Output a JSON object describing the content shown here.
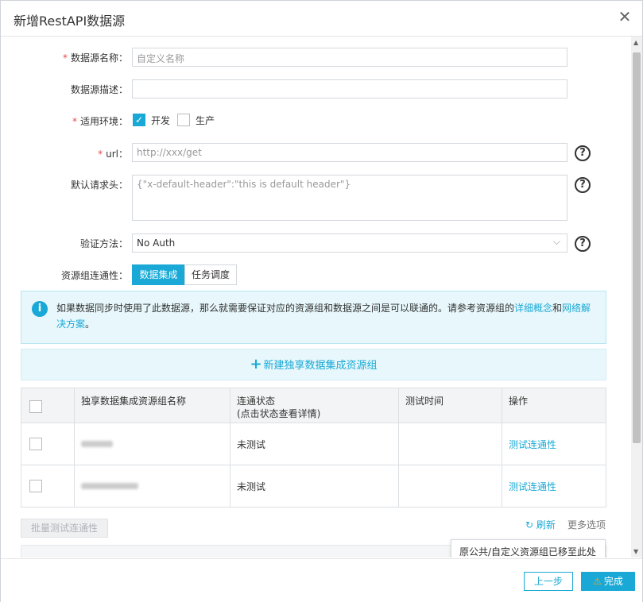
{
  "dialog": {
    "title": "新增RestAPI数据源",
    "close_glyph": "✕"
  },
  "form": {
    "name": {
      "label": "数据源名称：",
      "placeholder": "自定义名称",
      "required": true
    },
    "desc": {
      "label": "数据源描述：",
      "value": ""
    },
    "env": {
      "label": "适用环境：",
      "options": [
        {
          "label": "开发",
          "checked": true
        },
        {
          "label": "生产",
          "checked": false
        }
      ]
    },
    "url": {
      "label": "url：",
      "placeholder": "http://xxx/get"
    },
    "headers": {
      "label": "默认请求头：",
      "placeholder": "{\"x-default-header\":\"this is default header\"}"
    },
    "auth": {
      "label": "验证方法：",
      "value": "No Auth"
    },
    "resource_group": {
      "label": "资源组连通性：",
      "tabs": [
        "数据集成",
        "任务调度"
      ],
      "active": 0
    }
  },
  "notice": {
    "text": "如果数据同步时使用了此数据源，那么就需要保证对应的资源组和数据源之间是可以联通的。请参考资源组的",
    "link1": "详细概念",
    "and": "和",
    "link2": "网络解决方案",
    "end": "。"
  },
  "add_bar": {
    "label": "新建独享数据集成资源组"
  },
  "table": {
    "headers": [
      "独享数据集成资源组名称",
      "连通状态",
      "(点击状态查看详情)",
      "测试时间",
      "操作"
    ],
    "rows": [
      {
        "name_blurred": true,
        "status": "未测试",
        "time": "",
        "action": "测试连通性"
      },
      {
        "name_blurred": true,
        "status": "未测试",
        "time": "",
        "action": "测试连通性"
      }
    ]
  },
  "bottom": {
    "batch_label": "批量测试连通性",
    "refresh_label": "刷新",
    "more_label": "更多选项",
    "tooltip": "原公共/自定义资源组已移至此处"
  },
  "footer": {
    "prev_label": "上一步",
    "done_label": "完成"
  },
  "colors": {
    "accent": "#1aa9d6",
    "required": "#e24b4b",
    "warning": "#f5a623"
  }
}
